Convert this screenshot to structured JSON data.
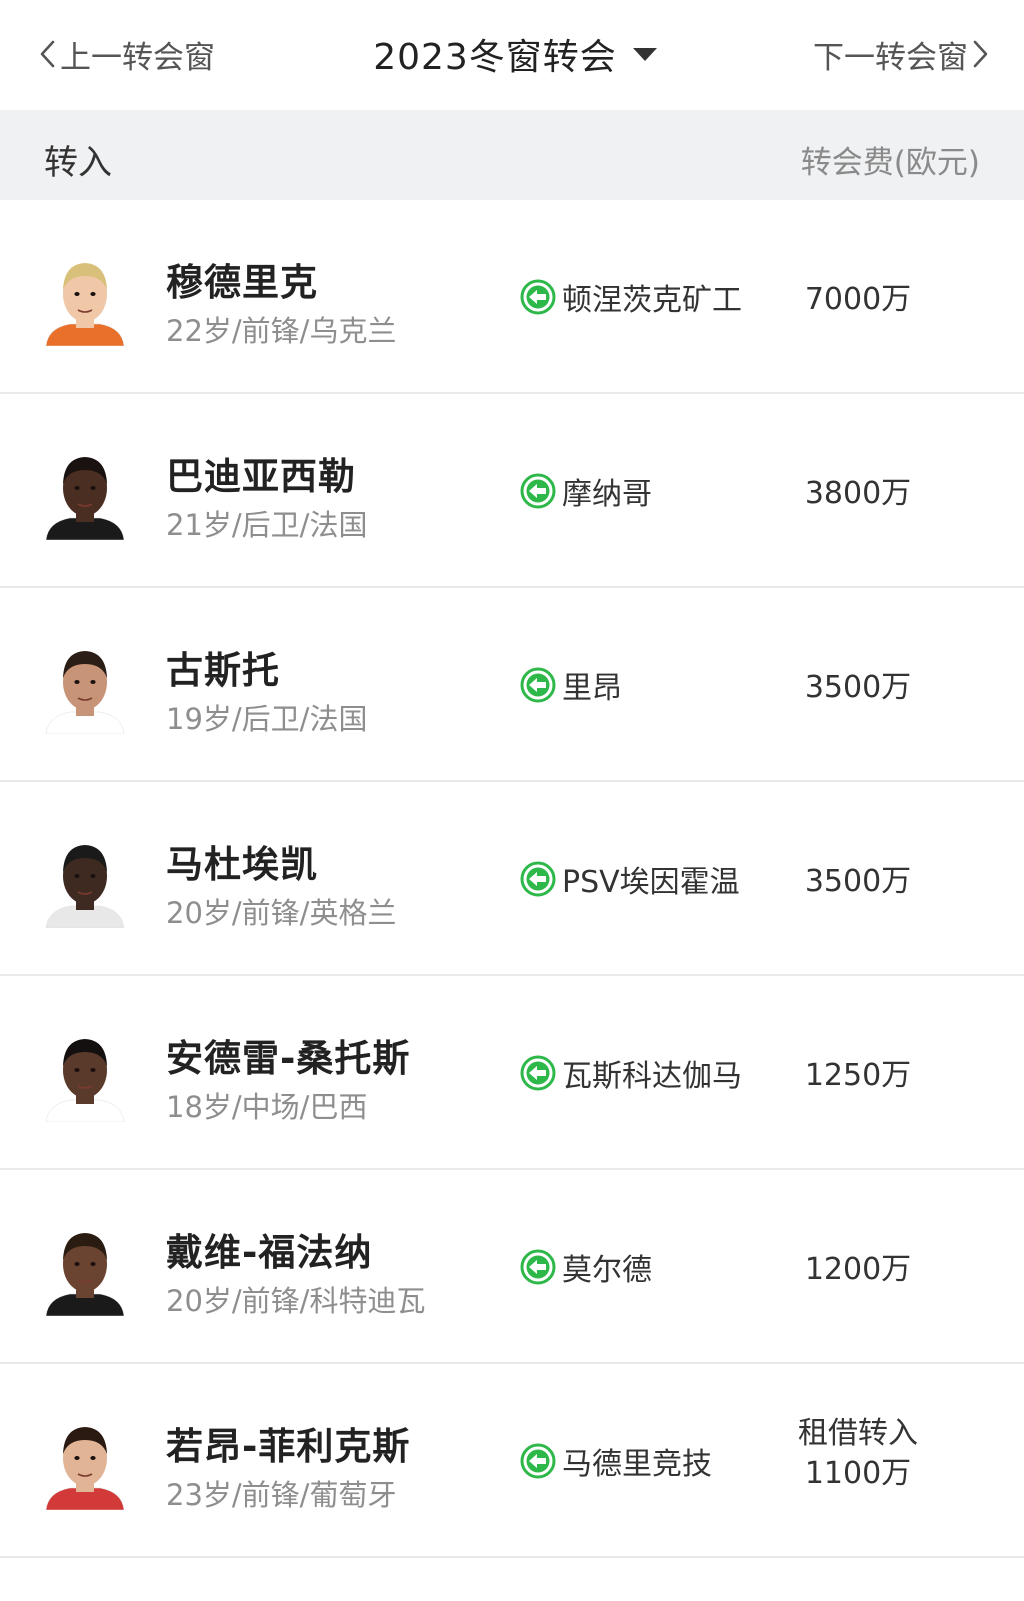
{
  "nav": {
    "prev_label": "上一转会窗",
    "title": "2023冬窗转会",
    "next_label": "下一转会窗"
  },
  "section": {
    "left_label": "转入",
    "right_label": "转会费(欧元)"
  },
  "colors": {
    "accent_green": "#2fb84a",
    "header_bg": "#f0f1f3"
  },
  "players": [
    {
      "name": "穆德里克",
      "meta": "22岁/前锋/乌克兰",
      "from_club": "顿涅茨克矿工",
      "fee": "7000万"
    },
    {
      "name": "巴迪亚西勒",
      "meta": "21岁/后卫/法国",
      "from_club": "摩纳哥",
      "fee": "3800万"
    },
    {
      "name": "古斯托",
      "meta": "19岁/后卫/法国",
      "from_club": "里昂",
      "fee": "3500万"
    },
    {
      "name": "马杜埃凯",
      "meta": "20岁/前锋/英格兰",
      "from_club": "PSV埃因霍温",
      "fee": "3500万"
    },
    {
      "name": "安德雷-桑托斯",
      "meta": "18岁/中场/巴西",
      "from_club": "瓦斯科达伽马",
      "fee": "1250万"
    },
    {
      "name": "戴维-福法纳",
      "meta": "20岁/前锋/科特迪瓦",
      "from_club": "莫尔德",
      "fee": "1200万"
    },
    {
      "name": "若昂-菲利克斯",
      "meta": "23岁/前锋/葡萄牙",
      "from_club": "马德里竞技",
      "fee_line1": "租借转入",
      "fee_line2": "1100万"
    }
  ]
}
